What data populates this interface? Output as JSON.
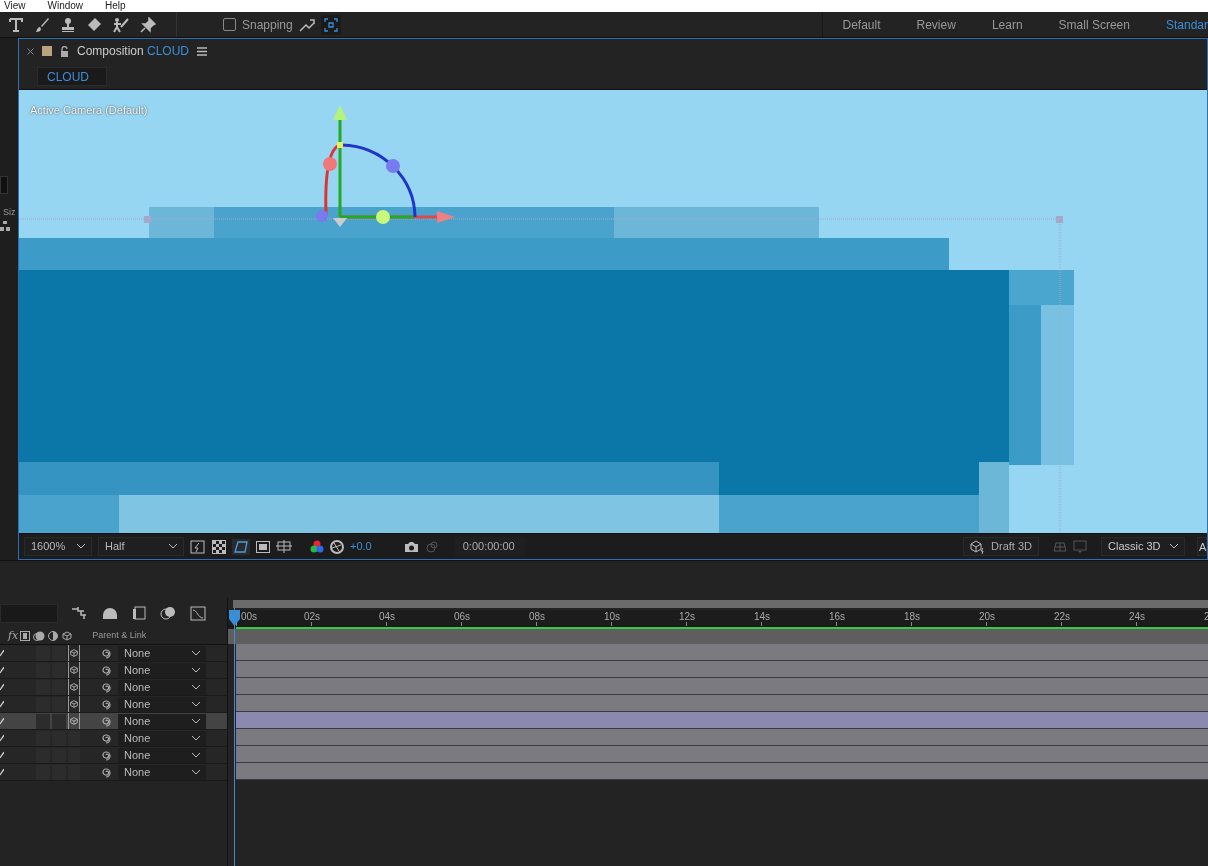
{
  "menu_bar": {
    "items": [
      "View",
      "Window",
      "Help"
    ]
  },
  "left_strip": {
    "column_label": "Siz"
  },
  "toolbar": {
    "snapping": {
      "label": "Snapping",
      "checked": false
    }
  },
  "workspaces": [
    {
      "label": "Default",
      "selected": false
    },
    {
      "label": "Review",
      "selected": false
    },
    {
      "label": "Learn",
      "selected": false
    },
    {
      "label": "Small Screen",
      "selected": false
    },
    {
      "label": "Standar",
      "selected": true
    }
  ],
  "composition_panel": {
    "title_prefix": "Composition",
    "comp_name": "CLOUD",
    "tabs": [
      {
        "label": "CLOUD",
        "selected": true
      }
    ]
  },
  "viewer": {
    "camera_label": "Active Camera (Default)"
  },
  "viewer_footer": {
    "zoom": "1600%",
    "resolution": "Half",
    "exposure": "+0.0",
    "timecode": "0:00:00:00",
    "draft_3d": "Draft 3D",
    "renderer": "Classic 3D",
    "cut_item": "A"
  },
  "timeline": {
    "effects_header": "fx",
    "column_header": "Parent & Link",
    "ruler": [
      "00s",
      "02s",
      "04s",
      "06s",
      "08s",
      "10s",
      "12s",
      "14s",
      "16s",
      "18s",
      "20s",
      "22s",
      "24s",
      "2"
    ],
    "layers": [
      {
        "three_d": true,
        "selected": false,
        "parent": "None"
      },
      {
        "three_d": true,
        "selected": false,
        "parent": "None"
      },
      {
        "three_d": true,
        "selected": false,
        "parent": "None"
      },
      {
        "three_d": true,
        "selected": false,
        "parent": "None"
      },
      {
        "three_d": true,
        "selected": true,
        "parent": "None"
      },
      {
        "three_d": false,
        "selected": false,
        "parent": "None"
      },
      {
        "three_d": false,
        "selected": false,
        "parent": "None"
      },
      {
        "three_d": false,
        "selected": false,
        "parent": "None"
      }
    ]
  }
}
